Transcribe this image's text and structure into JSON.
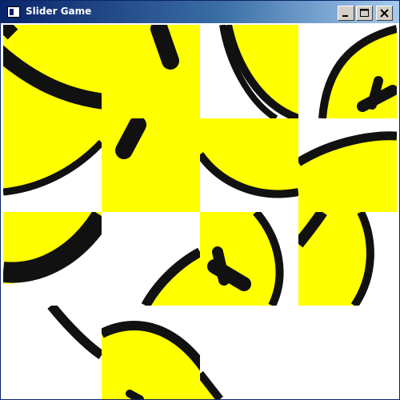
{
  "window": {
    "title": "Slider Game",
    "icon": "app-window-icon",
    "controls": [
      "minimize-icon",
      "maximize-icon",
      "close-icon"
    ]
  },
  "board": {
    "rows": 4,
    "cols": 4,
    "image": "yellow-smiley-face",
    "colors": {
      "face": "#ffff00",
      "outline": "#111111",
      "background": "#ffffff"
    },
    "empty_cell": {
      "row": 4,
      "col": 4
    }
  }
}
